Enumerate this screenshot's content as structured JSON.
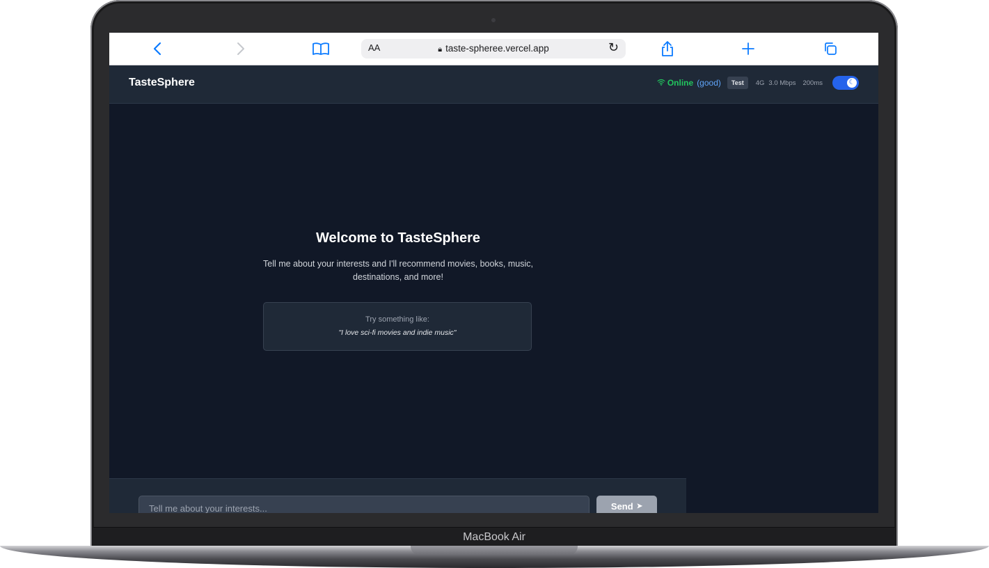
{
  "device": {
    "model_label": "MacBook Air"
  },
  "browser": {
    "text_size_label": "AA",
    "url": "taste-spheree.vercel.app",
    "icons": {
      "back": "chevron-left-icon",
      "forward": "chevron-right-icon",
      "bookmarks": "book-icon",
      "lock": "lock-icon",
      "reload": "reload-icon",
      "share": "share-icon",
      "new_tab": "plus-icon",
      "tabs": "tabs-icon"
    }
  },
  "app": {
    "brand": "TasteSphere",
    "status": {
      "online_label": "Online",
      "quality_label": "(good)",
      "test_label": "Test",
      "network_type": "4G",
      "speed": "3.0 Mbps",
      "latency": "200ms"
    },
    "welcome": {
      "title": "Welcome to TasteSphere",
      "description": "Tell me about your interests and I'll recommend movies, books, music, destinations, and more!",
      "try_title": "Try something like:",
      "try_example": "\"I love sci-fi movies and indie music\""
    },
    "chat": {
      "input_placeholder": "Tell me about your interests...",
      "send_label": "Send"
    },
    "colors": {
      "background": "#111827",
      "header": "#1f2937",
      "online": "#22c55e",
      "accent": "#2563eb"
    }
  }
}
